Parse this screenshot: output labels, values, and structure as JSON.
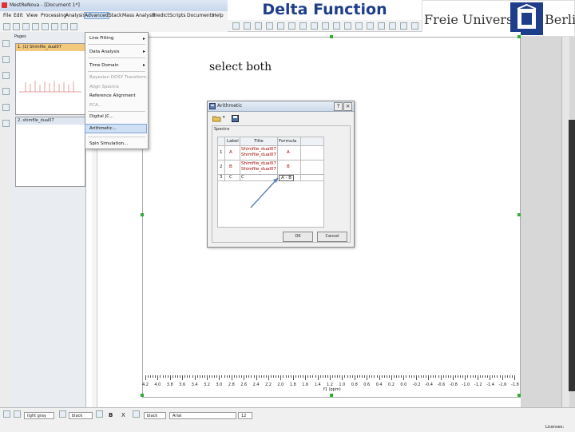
{
  "window": {
    "title": "MestReNova - [Document 1*]"
  },
  "slide": {
    "title": "Delta Function",
    "instruction": "select both"
  },
  "logo": {
    "left_text": "Freie Universität",
    "right_text": "Berlin"
  },
  "menubar": {
    "items": [
      "File",
      "Edit",
      "View",
      "Processing",
      "Analysis",
      "Advanced",
      "Stack",
      "Mass Analysis",
      "Predict",
      "Scripts",
      "Documents",
      "Help"
    ],
    "active": "Advanced"
  },
  "pages_pane": {
    "label": "Pages",
    "pages": [
      {
        "caption": "1. (1) Shimfile_dual07"
      },
      {
        "caption": "2. shimfile_dual07"
      }
    ]
  },
  "advanced_menu": {
    "items": [
      {
        "label": "Line Fitting",
        "submenu": true,
        "disabled": false
      },
      {
        "label": "Data Analysis",
        "submenu": true,
        "disabled": false
      },
      {
        "label": "Time Domain",
        "submenu": true,
        "disabled": false
      },
      {
        "label": "Bayesian DOSY Transform...",
        "submenu": false,
        "disabled": true
      },
      {
        "label": "Align Spectra",
        "submenu": false,
        "disabled": true
      },
      {
        "label": "Reference Alignment",
        "submenu": false,
        "disabled": false
      },
      {
        "label": "PCA...",
        "submenu": false,
        "disabled": true
      },
      {
        "label": "Digital JC...",
        "submenu": false,
        "disabled": false
      },
      {
        "label": "Arithmetic...",
        "submenu": false,
        "disabled": false,
        "selected": true
      },
      {
        "label": "Spin Simulation...",
        "submenu": false,
        "disabled": false
      }
    ]
  },
  "dialog": {
    "title": "Arithmetic",
    "group_label": "Spectra",
    "headers": [
      "Label",
      "Title",
      "Formula"
    ],
    "rows": [
      {
        "index": "1",
        "label": "A",
        "title_lines": [
          "Shimfile_dual07",
          "Shimfile_dual07"
        ],
        "formula": "A"
      },
      {
        "index": "2",
        "label": "B",
        "title_lines": [
          "Shimfile_dual07",
          "Shimfile_dual07"
        ],
        "formula": "B"
      },
      {
        "index": "3",
        "label": "C",
        "title_lines": [
          "C"
        ],
        "formula": "A - B"
      }
    ],
    "ok": "OK",
    "cancel": "Cancel"
  },
  "ruler": {
    "labels": [
      "4.2",
      "4.0",
      "3.8",
      "3.6",
      "3.4",
      "3.2",
      "3.0",
      "2.8",
      "2.6",
      "2.4",
      "2.2",
      "2.0",
      "1.8",
      "1.6",
      "1.4",
      "1.2",
      "1.0",
      "0.8",
      "0.6",
      "0.4",
      "0.2",
      "0.0",
      "-0.2",
      "-0.4",
      "-0.6",
      "-0.8",
      "-1.0",
      "-1.2",
      "-1.4",
      "-1.6",
      "-1.8"
    ],
    "unit": "f1 (ppm)"
  },
  "bottom_toolbar": {
    "color_a": "light gray",
    "color_b": "black",
    "color_c": "black",
    "font": "Arial",
    "font_size": "12"
  },
  "status": {
    "license": "Licenses:"
  },
  "colors": {
    "heading": "#1f3e8a",
    "menu_highlight": "#cfe0f4",
    "thumb_caption": "#f3c97e",
    "handle": "#33aa33"
  }
}
